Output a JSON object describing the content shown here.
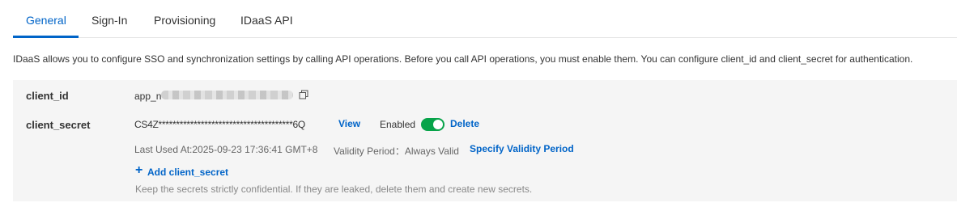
{
  "tabs": [
    {
      "label": "General",
      "active": true
    },
    {
      "label": "Sign-In",
      "active": false
    },
    {
      "label": "Provisioning",
      "active": false
    },
    {
      "label": "IDaaS API",
      "active": false
    }
  ],
  "intro_text": "IDaaS allows you to configure SSO and synchronization settings by calling API operations. Before you call API operations, you must enable them. You can configure client_id and client_secret for authentication.",
  "client_id": {
    "label": "client_id",
    "value_prefix": "app_n",
    "value_obscured": true,
    "copy_icon": "copy-icon"
  },
  "client_secret": {
    "label": "client_secret",
    "masked_value": "CS4Z**************************************6Q",
    "view_label": "View",
    "status_label": "Enabled",
    "enabled": true,
    "delete_label": "Delete",
    "last_used": "Last Used At:2025-09-23 17:36:41 GMT+8",
    "validity_label": "Validity Period：Always Valid",
    "specify_validity_label": "Specify Validity Period"
  },
  "add_secret": {
    "icon": "plus-icon",
    "label": "Add client_secret"
  },
  "hint_text": "Keep the secrets strictly confidential. If they are leaked, delete them and create new secrets.",
  "colors": {
    "accent": "#0064c8",
    "toggle_on": "#07a349",
    "panel_bg": "#f5f5f5"
  }
}
